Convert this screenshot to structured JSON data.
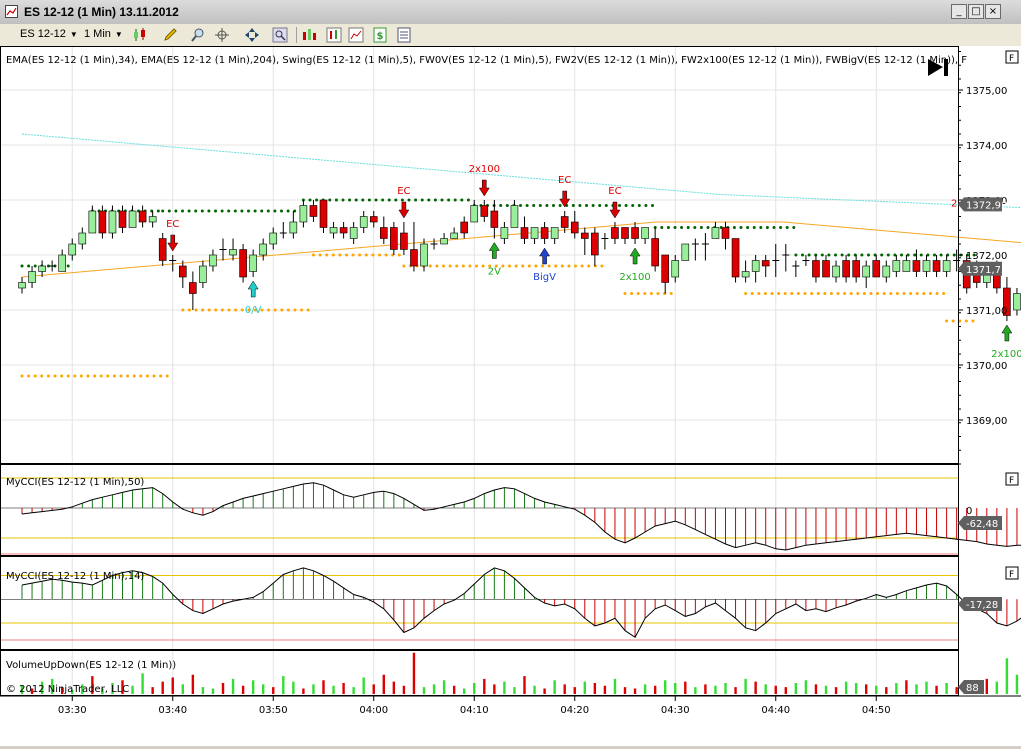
{
  "window": {
    "title": "ES 12-12 (1 Min)  13.11.2012",
    "minimize_label": "_",
    "maximize_label": "□",
    "close_label": "×"
  },
  "toolbar": {
    "instrument": "ES 12-12",
    "interval": "1 Min",
    "icons": [
      "candlestick-icon",
      "pencil-icon",
      "zoom-icon",
      "crosshair-icon",
      "move-icon",
      "search-icon",
      "indicator-icon",
      "strategy-icon",
      "dollar-icon",
      "properties-icon"
    ]
  },
  "price_panel": {
    "indicator_label": "EMA(ES 12-12 (1 Min),34), EMA(ES 12-12 (1 Min),204), Swing(ES 12-12 (1 Min),5), FW0V(ES 12-12 (1 Min),5), FW2V(ES 12-12 (1 Min)), FW2x100(ES 12-12 (1 Min)), FWBigV(ES 12-12 (1 Min)), F",
    "f_badge": "F",
    "price_marker": "1372,92",
    "price_marker_value": 1372.92,
    "price_marker2": "1371,75",
    "price_marker2_value": 1371.75,
    "marker_small": "2",
    "y_ticks": [
      "1375,00",
      "1374,00",
      "1373,00",
      "1372,00",
      "1371,00",
      "1370,00",
      "1369,00"
    ],
    "y_tick_values": [
      1375,
      1374,
      1373,
      1372,
      1371,
      1370,
      1369
    ],
    "colors": {
      "up": "#99ee99",
      "down": "#dd0000",
      "ema_fast": "#f5a623",
      "ema_slow": "#66dddd",
      "swing_high": "#006400",
      "swing_low": "#ffa500"
    }
  },
  "cci50_panel": {
    "label": "MyCCI(ES 12-12 (1 Min),50)",
    "f_badge": "F",
    "value_label": "-62,48",
    "zero_label": "0"
  },
  "cci14_panel": {
    "label": "MyCCI(ES 12-12 (1 Min),14)",
    "f_badge": "F",
    "value_label": "-17,28"
  },
  "volume_panel": {
    "label": "VolumeUpDown(ES 12-12 (1 Min))",
    "copyright": "© 2012 NinjaTrader, LLC",
    "value_label": "88"
  },
  "x_axis": {
    "ticks": [
      "03:30",
      "03:40",
      "03:50",
      "04:00",
      "04:10",
      "04:20",
      "04:30",
      "04:40",
      "04:50"
    ]
  },
  "chart_data": {
    "type": "candlestick",
    "title": "ES 12-12 (1 Min)  13.11.2012",
    "x_start": "03:25",
    "interval": "1 Min",
    "ylim": [
      1368.2,
      1375.8
    ],
    "ohlc": [
      [
        1371.4,
        1371.6,
        1371.3,
        1371.5
      ],
      [
        1371.5,
        1371.8,
        1371.4,
        1371.7
      ],
      [
        1371.7,
        1371.9,
        1371.6,
        1371.8
      ],
      [
        1371.8,
        1371.9,
        1371.7,
        1371.8
      ],
      [
        1371.7,
        1372.1,
        1371.7,
        1372.0
      ],
      [
        1372.0,
        1372.3,
        1371.9,
        1372.2
      ],
      [
        1372.2,
        1372.5,
        1372.1,
        1372.4
      ],
      [
        1372.4,
        1372.9,
        1372.4,
        1372.8
      ],
      [
        1372.8,
        1372.9,
        1372.3,
        1372.4
      ],
      [
        1372.4,
        1372.9,
        1372.3,
        1372.8
      ],
      [
        1372.8,
        1372.9,
        1372.4,
        1372.5
      ],
      [
        1372.5,
        1372.9,
        1372.5,
        1372.8
      ],
      [
        1372.8,
        1372.9,
        1372.5,
        1372.6
      ],
      [
        1372.6,
        1372.8,
        1372.5,
        1372.7
      ],
      [
        1372.3,
        1372.4,
        1371.8,
        1371.9
      ],
      [
        1371.9,
        1372.0,
        1371.7,
        1371.9
      ],
      [
        1371.8,
        1371.9,
        1371.4,
        1371.6
      ],
      [
        1371.5,
        1371.7,
        1371.0,
        1371.3
      ],
      [
        1371.5,
        1371.9,
        1371.4,
        1371.8
      ],
      [
        1371.8,
        1372.1,
        1371.7,
        1372.0
      ],
      [
        1372.1,
        1372.3,
        1371.9,
        1372.1
      ],
      [
        1372.0,
        1372.3,
        1371.9,
        1372.1
      ],
      [
        1372.1,
        1372.2,
        1371.5,
        1371.6
      ],
      [
        1371.7,
        1372.1,
        1371.6,
        1372.0
      ],
      [
        1372.0,
        1372.3,
        1371.9,
        1372.2
      ],
      [
        1372.2,
        1372.5,
        1372.1,
        1372.4
      ],
      [
        1372.4,
        1372.6,
        1372.3,
        1372.4
      ],
      [
        1372.4,
        1372.8,
        1372.3,
        1372.6
      ],
      [
        1372.6,
        1373.0,
        1372.5,
        1372.9
      ],
      [
        1372.9,
        1373.0,
        1372.6,
        1372.7
      ],
      [
        1373.0,
        1373.0,
        1372.4,
        1372.5
      ],
      [
        1372.4,
        1372.6,
        1372.3,
        1372.5
      ],
      [
        1372.5,
        1372.6,
        1372.3,
        1372.4
      ],
      [
        1372.3,
        1372.6,
        1372.2,
        1372.5
      ],
      [
        1372.5,
        1372.8,
        1372.4,
        1372.7
      ],
      [
        1372.7,
        1372.8,
        1372.5,
        1372.6
      ],
      [
        1372.5,
        1372.7,
        1372.2,
        1372.3
      ],
      [
        1372.5,
        1372.6,
        1372.0,
        1372.1
      ],
      [
        1372.4,
        1372.6,
        1372.0,
        1372.1
      ],
      [
        1372.1,
        1372.6,
        1371.7,
        1371.8
      ],
      [
        1371.8,
        1372.3,
        1371.7,
        1372.2
      ],
      [
        1372.2,
        1372.3,
        1372.1,
        1372.2
      ],
      [
        1372.2,
        1372.4,
        1372.2,
        1372.3
      ],
      [
        1372.3,
        1372.5,
        1372.3,
        1372.4
      ],
      [
        1372.6,
        1372.7,
        1372.3,
        1372.4
      ],
      [
        1372.6,
        1373.0,
        1372.6,
        1372.9
      ],
      [
        1372.9,
        1373.0,
        1372.6,
        1372.7
      ],
      [
        1372.8,
        1373.0,
        1372.3,
        1372.5
      ],
      [
        1372.3,
        1372.6,
        1372.2,
        1372.5
      ],
      [
        1372.5,
        1373.0,
        1372.5,
        1372.9
      ],
      [
        1372.5,
        1372.7,
        1372.2,
        1372.3
      ],
      [
        1372.3,
        1372.5,
        1372.2,
        1372.5
      ],
      [
        1372.5,
        1372.6,
        1372.2,
        1372.3
      ],
      [
        1372.3,
        1372.5,
        1372.2,
        1372.5
      ],
      [
        1372.7,
        1372.8,
        1372.4,
        1372.5
      ],
      [
        1372.6,
        1372.8,
        1372.3,
        1372.4
      ],
      [
        1372.4,
        1372.5,
        1372.0,
        1372.3
      ],
      [
        1372.4,
        1372.5,
        1371.8,
        1372.0
      ],
      [
        1372.3,
        1372.4,
        1372.1,
        1372.3
      ],
      [
        1372.5,
        1372.6,
        1372.2,
        1372.3
      ],
      [
        1372.5,
        1372.5,
        1372.2,
        1372.3
      ],
      [
        1372.5,
        1372.6,
        1372.2,
        1372.3
      ],
      [
        1372.3,
        1372.5,
        1372.2,
        1372.5
      ],
      [
        1372.3,
        1372.5,
        1371.7,
        1371.8
      ],
      [
        1372.0,
        1372.0,
        1371.3,
        1371.5
      ],
      [
        1371.6,
        1372.0,
        1371.5,
        1371.9
      ],
      [
        1371.9,
        1372.2,
        1371.9,
        1372.2
      ],
      [
        1372.2,
        1372.3,
        1371.9,
        1372.2
      ],
      [
        1372.2,
        1372.4,
        1371.9,
        1372.2
      ],
      [
        1372.3,
        1372.6,
        1372.3,
        1372.5
      ],
      [
        1372.5,
        1372.6,
        1372.1,
        1372.3
      ],
      [
        1372.3,
        1372.3,
        1371.5,
        1371.6
      ],
      [
        1371.6,
        1371.9,
        1371.5,
        1371.7
      ],
      [
        1371.7,
        1372.0,
        1371.5,
        1371.9
      ],
      [
        1371.9,
        1372.0,
        1371.6,
        1371.8
      ],
      [
        1371.9,
        1372.2,
        1371.6,
        1371.9
      ],
      [
        1372.0,
        1372.2,
        1371.7,
        1372.0
      ],
      [
        1371.8,
        1371.9,
        1371.6,
        1371.8
      ],
      [
        1371.9,
        1372.0,
        1371.8,
        1371.9
      ],
      [
        1371.9,
        1372.0,
        1371.5,
        1371.6
      ],
      [
        1371.9,
        1372.0,
        1371.6,
        1371.6
      ],
      [
        1371.6,
        1371.9,
        1371.5,
        1371.8
      ],
      [
        1371.9,
        1372.0,
        1371.5,
        1371.6
      ],
      [
        1371.9,
        1372.0,
        1371.5,
        1371.6
      ],
      [
        1371.6,
        1371.9,
        1371.4,
        1371.8
      ],
      [
        1371.9,
        1372.0,
        1371.6,
        1371.6
      ],
      [
        1371.6,
        1371.9,
        1371.5,
        1371.8
      ],
      [
        1371.7,
        1372.0,
        1371.6,
        1371.9
      ],
      [
        1371.7,
        1372.0,
        1371.7,
        1371.9
      ],
      [
        1371.9,
        1372.1,
        1371.6,
        1371.7
      ],
      [
        1371.7,
        1372.0,
        1371.6,
        1371.9
      ],
      [
        1371.9,
        1372.0,
        1371.6,
        1371.7
      ],
      [
        1371.7,
        1372.0,
        1371.6,
        1371.9
      ],
      [
        1371.9,
        1372.1,
        1371.7,
        1371.9
      ],
      [
        1371.9,
        1372.0,
        1371.3,
        1371.4
      ],
      [
        1371.8,
        1371.9,
        1371.4,
        1371.5
      ],
      [
        1371.5,
        1371.8,
        1371.4,
        1371.8
      ],
      [
        1371.8,
        1371.9,
        1371.3,
        1371.4
      ],
      [
        1371.4,
        1371.6,
        1370.8,
        1370.9
      ],
      [
        1371.0,
        1371.4,
        1370.9,
        1371.3
      ],
      [
        1371.5,
        1371.9,
        1371.4,
        1371.8
      ],
      [
        1371.5,
        1371.9,
        1371.5,
        1371.8
      ]
    ],
    "ema34": [
      1371.6,
      1371.7,
      1371.8,
      1371.9,
      1372.0,
      1372.1,
      1372.2,
      1372.3,
      1372.4,
      1372.5,
      1372.6,
      1372.6,
      1372.6,
      1372.5,
      1372.4,
      1372.3,
      1372.2
    ],
    "ema204": [
      1374.2,
      1374.1,
      1374.0,
      1373.9,
      1373.8,
      1373.7,
      1373.6,
      1373.5,
      1373.4,
      1373.3,
      1373.2,
      1373.1,
      1373.05,
      1373.0,
      1372.95,
      1372.9,
      1372.85
    ],
    "swing_high": [
      {
        "from": 0,
        "to": 5,
        "price": 1371.8
      },
      {
        "from": 7,
        "to": 14,
        "price": 1372.8
      },
      {
        "from": 14,
        "to": 28,
        "price": 1372.8
      },
      {
        "from": 28,
        "to": 45,
        "price": 1373.0
      },
      {
        "from": 45,
        "to": 63,
        "price": 1372.9
      },
      {
        "from": 63,
        "to": 77,
        "price": 1372.5
      },
      {
        "from": 77,
        "to": 95,
        "price": 1372.0
      }
    ],
    "swing_low": [
      {
        "from": 0,
        "to": 15,
        "price": 1369.8
      },
      {
        "from": 16,
        "to": 29,
        "price": 1371.0
      },
      {
        "from": 29,
        "to": 38,
        "price": 1372.0
      },
      {
        "from": 38,
        "to": 58,
        "price": 1371.8
      },
      {
        "from": 60,
        "to": 65,
        "price": 1371.3
      },
      {
        "from": 72,
        "to": 92,
        "price": 1371.3
      },
      {
        "from": 92,
        "to": 95,
        "price": 1370.8
      }
    ],
    "signals": [
      {
        "bar": 15,
        "dir": "down",
        "color": "#dd0000",
        "text": "EC"
      },
      {
        "bar": 23,
        "dir": "up",
        "color": "#22cccc",
        "text": "0/V"
      },
      {
        "bar": 38,
        "dir": "down",
        "color": "#dd0000",
        "text": "EC"
      },
      {
        "bar": 46,
        "dir": "down",
        "color": "#dd0000",
        "text": "2x100"
      },
      {
        "bar": 47,
        "dir": "up",
        "color": "#22aa22",
        "text": "2V"
      },
      {
        "bar": 52,
        "dir": "up",
        "color": "#2244cc",
        "text": "BigV"
      },
      {
        "bar": 54,
        "dir": "down",
        "color": "#dd0000",
        "text": "EC"
      },
      {
        "bar": 59,
        "dir": "down",
        "color": "#dd0000",
        "text": "EC"
      },
      {
        "bar": 61,
        "dir": "up",
        "color": "#22aa22",
        "text": "2x100"
      },
      {
        "bar": 98,
        "dir": "up",
        "color": "#22aa22",
        "text": "2x100"
      }
    ],
    "cci50": [
      -10,
      -8,
      -6,
      -4,
      -2,
      2,
      8,
      14,
      18,
      22,
      26,
      30,
      32,
      34,
      24,
      10,
      -2,
      -8,
      -12,
      -6,
      4,
      10,
      16,
      20,
      24,
      28,
      32,
      36,
      40,
      42,
      38,
      30,
      22,
      18,
      22,
      26,
      28,
      24,
      16,
      6,
      -4,
      -2,
      2,
      6,
      10,
      16,
      24,
      30,
      34,
      32,
      24,
      16,
      10,
      6,
      2,
      -2,
      -12,
      -24,
      -40,
      -52,
      -58,
      -50,
      -40,
      -30,
      -26,
      -22,
      -28,
      -36,
      -44,
      -52,
      -60,
      -66,
      -62,
      -58,
      -62,
      -68,
      -70,
      -66,
      -62,
      -60,
      -58,
      -56,
      -54,
      -52,
      -50,
      -48,
      -46,
      -44,
      -42,
      -44,
      -46,
      -48,
      -50,
      -52,
      -54,
      -56,
      -60,
      -62,
      -64,
      -62,
      -62
    ],
    "cci14": [
      30,
      34,
      38,
      42,
      40,
      36,
      34,
      30,
      40,
      50,
      56,
      60,
      56,
      48,
      34,
      10,
      -10,
      -24,
      -30,
      -20,
      -10,
      -4,
      0,
      4,
      16,
      34,
      52,
      60,
      66,
      60,
      50,
      38,
      24,
      10,
      4,
      -6,
      -20,
      -44,
      -70,
      -60,
      -40,
      -24,
      -10,
      -2,
      12,
      32,
      52,
      66,
      60,
      44,
      24,
      4,
      -8,
      -14,
      -10,
      -20,
      -40,
      -56,
      -50,
      -40,
      -66,
      -80,
      -40,
      -20,
      -12,
      -24,
      -36,
      -30,
      -16,
      -8,
      -24,
      -40,
      -60,
      -66,
      -50,
      -30,
      -20,
      -10,
      -24,
      -20,
      -26,
      -18,
      -12,
      -4,
      2,
      10,
      4,
      10,
      18,
      24,
      30,
      34,
      28,
      10,
      -10,
      -20,
      -30,
      -50,
      -56,
      -46,
      -30,
      -20
    ],
    "volume": [
      12,
      8,
      18,
      22,
      10,
      6,
      14,
      26,
      8,
      16,
      20,
      12,
      30,
      10,
      18,
      24,
      14,
      28,
      10,
      8,
      16,
      22,
      12,
      20,
      14,
      10,
      26,
      18,
      8,
      14,
      20,
      12,
      16,
      10,
      24,
      14,
      28,
      18,
      12,
      60,
      10,
      14,
      20,
      12,
      8,
      16,
      22,
      14,
      18,
      10,
      26,
      12,
      8,
      20,
      14,
      10,
      18,
      16,
      12,
      22,
      10,
      8,
      14,
      12,
      20,
      16,
      18,
      10,
      14,
      12,
      16,
      10,
      22,
      18,
      14,
      12,
      10,
      16,
      20,
      14,
      12,
      10,
      18,
      16,
      14,
      12,
      10,
      16,
      20,
      14,
      18,
      12,
      16,
      10,
      14,
      12,
      22,
      18,
      52,
      28
    ],
    "volume_up": [
      true,
      false,
      true,
      true,
      false,
      true,
      true,
      false,
      true,
      true,
      false,
      true,
      true,
      false,
      false,
      false,
      true,
      false,
      true,
      true,
      false,
      true,
      false,
      true,
      true,
      false,
      true,
      true,
      false,
      true,
      false,
      true,
      false,
      true,
      true,
      false,
      false,
      false,
      false,
      false,
      true,
      true,
      true,
      false,
      true,
      true,
      false,
      false,
      true,
      true,
      false,
      true,
      false,
      true,
      false,
      false,
      true,
      false,
      false,
      true,
      false,
      false,
      true,
      false,
      true,
      true,
      false,
      true,
      false,
      true,
      true,
      false,
      true,
      false,
      true,
      false,
      false,
      true,
      true,
      false,
      true,
      false,
      true,
      true,
      false,
      true,
      false,
      true,
      false,
      true,
      true,
      false,
      true,
      false,
      true,
      false,
      false,
      true,
      true,
      true
    ],
    "cci50_ylim": [
      -80,
      50
    ],
    "cci14_ylim": [
      -90,
      70
    ],
    "volume_ylim": [
      0,
      64
    ]
  }
}
